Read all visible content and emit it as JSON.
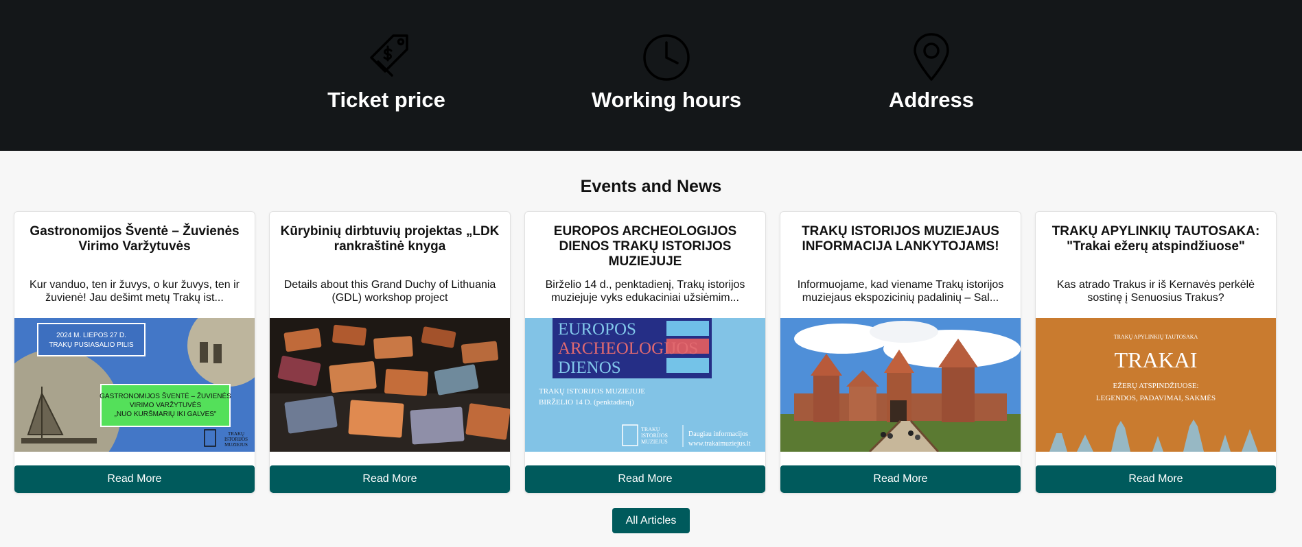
{
  "info_bar": {
    "items": [
      {
        "label": "Ticket price",
        "icon": "price-tag-icon"
      },
      {
        "label": "Working hours",
        "icon": "clock-icon"
      },
      {
        "label": "Address",
        "icon": "map-pin-icon"
      }
    ]
  },
  "events": {
    "title": "Events and News",
    "cards": [
      {
        "title": "Gastronomijos Šventė – Žuvienės Virimo Varžytuvės",
        "desc": "Kur vanduo, ten ir žuvys, o kur žuvys, ten ir žuvienė! Jau dešimt metų Trakų ist...",
        "image": {
          "date_line1": "2024 M. LIEPOS 27 D.",
          "date_line2": "TRAKŲ PUSIASALIO PILIS",
          "green_line1": "GASTRONOMIJOS ŠVENTĖ – ŽUVIENĖS",
          "green_line2": "VIRIMO VARŽYTUVĖS",
          "green_line3": "„NUO KURŠMARIŲ IKI GALVES\"",
          "logo_line1": "TRAKŲ",
          "logo_line2": "ISTORIJOS",
          "logo_line3": "MUZIEJUS"
        },
        "button": "Read More"
      },
      {
        "title": "Kūrybinių dirbtuvių projektas „LDK rankraštinė knyga",
        "desc": "Details about this Grand Duchy of Lithuania (GDL) workshop project",
        "button": "Read More"
      },
      {
        "title": "EUROPOS ARCHEOLOGIJOS DIENOS TRAKŲ ISTORIJOS MUZIEJUJE",
        "desc": "Birželio 14 d., penktadienį, Trakų istorijos muziejuje vyks edukaciniai užsiėmim...",
        "image": {
          "line1": "EUROPOS",
          "line2": "ARCHEOLOGIJOS",
          "line3": "DIENOS",
          "sub1": "TRAKŲ ISTORIJOS MUZIEJUJE",
          "sub2": "BIRŽELIO 14 D. (penktadienį)",
          "logo_line1": "TRAKŲ",
          "logo_line2": "ISTORIJOS",
          "logo_line3": "MUZIEJUS",
          "more_info": "Daugiau informacijos",
          "url": "www.trakaimuziejus.lt"
        },
        "button": "Read More"
      },
      {
        "title": "TRAKŲ ISTORIJOS MUZIEJAUS INFORMACIJA LANKYTOJAMS!",
        "desc": "Informuojame, kad viename Trakų istorijos muziejaus ekspozicinių padalinių – Sal...",
        "button": "Read More"
      },
      {
        "title": "TRAKŲ APYLINKIŲ TAUTOSAKA: \"Trakai ežerų atspindžiuose\"",
        "desc": "Kas atrado Trakus ir iš Kernavės perkėlė sostinę į Senuosius Trakus?",
        "image": {
          "small": "TRAKŲ APYLINKIŲ TAUTOSAKA",
          "big": "TRAKAI",
          "sub1": "EŽERŲ ATSPINDŽIUOSE:",
          "sub2": "LEGENDOS, PADAVIMAI, SAKMĖS"
        },
        "button": "Read More"
      }
    ],
    "all_button": "All Articles"
  },
  "colors": {
    "top_band": "#141719",
    "button_teal": "#005a5c",
    "page_bg": "#f7f7f7"
  }
}
